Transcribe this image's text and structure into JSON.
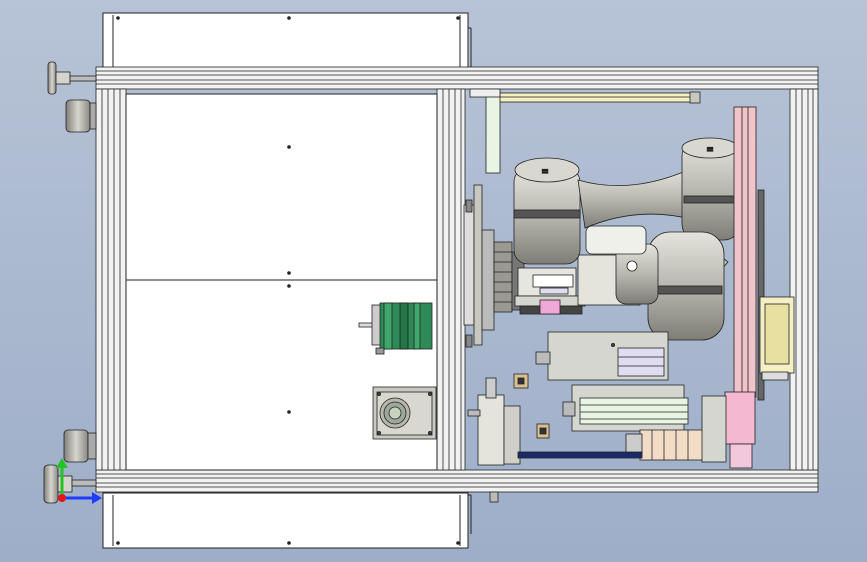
{
  "viewport": {
    "background_top": "#b7c3d6",
    "background_bottom": "#9eaec8",
    "model_line_color": "#1a1a1a",
    "panel_fill": "#ffffff",
    "frame_fill": "#ededed",
    "robot_fill": "#c4c4bc",
    "robot_dark": "#6e6e68",
    "motor_green": "#2e8b57",
    "accent_pink": "#f0c4c8",
    "accent_lavender": "#e0dcf2",
    "accent_beige": "#f3dcc6",
    "accent_yellow": "#f5f0c0",
    "accent_mint": "#e8f5e4",
    "rail_blue": "#1c2a6b"
  },
  "triad": {
    "icon": "axis-triad-icon",
    "x_color": "#1f3cff",
    "y_color": "#22c322",
    "z_color": "#e01818"
  }
}
